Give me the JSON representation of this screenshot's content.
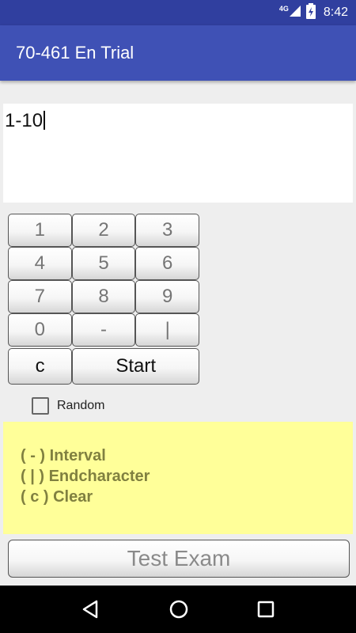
{
  "status_bar": {
    "network": "4G",
    "time": "8:42"
  },
  "app_bar": {
    "title": "70-461 En Trial"
  },
  "input": {
    "value": "1-10"
  },
  "keypad": {
    "rows": [
      [
        "1",
        "2",
        "3"
      ],
      [
        "4",
        "5",
        "6"
      ],
      [
        "7",
        "8",
        "9"
      ],
      [
        "0",
        "-",
        "|"
      ]
    ],
    "clear_label": "c",
    "start_label": "Start"
  },
  "random": {
    "label": "Random",
    "checked": false
  },
  "help": {
    "lines": [
      "( - ) Interval",
      "( | )  Endcharacter",
      "( c )  Clear"
    ]
  },
  "test_button": {
    "label": "Test Exam"
  },
  "colors": {
    "status_bar": "#303f9f",
    "app_bar": "#3f51b5",
    "help_background": "#ffff99",
    "help_text": "#808040"
  },
  "icons": {
    "network": "signal-icon",
    "battery": "battery-charging-icon",
    "nav_back": "back-icon",
    "nav_home": "home-icon",
    "nav_recents": "recents-icon"
  }
}
